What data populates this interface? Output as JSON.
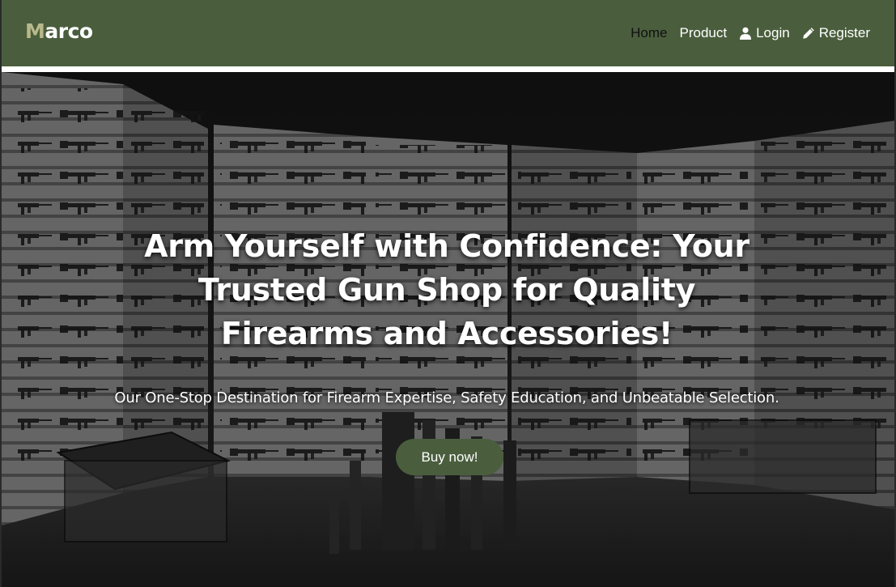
{
  "brand": {
    "first_letter": "M",
    "rest": "arco"
  },
  "nav": {
    "items": [
      {
        "label": "Home",
        "active": true,
        "icon": null
      },
      {
        "label": "Product",
        "active": false,
        "icon": null
      },
      {
        "label": "Login",
        "active": false,
        "icon": "user-icon"
      },
      {
        "label": "Register",
        "active": false,
        "icon": "pencil-icon"
      }
    ]
  },
  "hero": {
    "title": "Arm Yourself with Confidence: Your Trusted Gun Shop for Quality Firearms and Accessories!",
    "subtitle": "Our One-Stop Destination for Firearm Expertise, Safety Education, and Unbeatable Selection.",
    "cta_label": "Buy now!"
  },
  "colors": {
    "navbar": "#4a5e3d",
    "brand_accent": "#b8b88a",
    "button": "#4a5e3d",
    "active_link": "#111111"
  }
}
